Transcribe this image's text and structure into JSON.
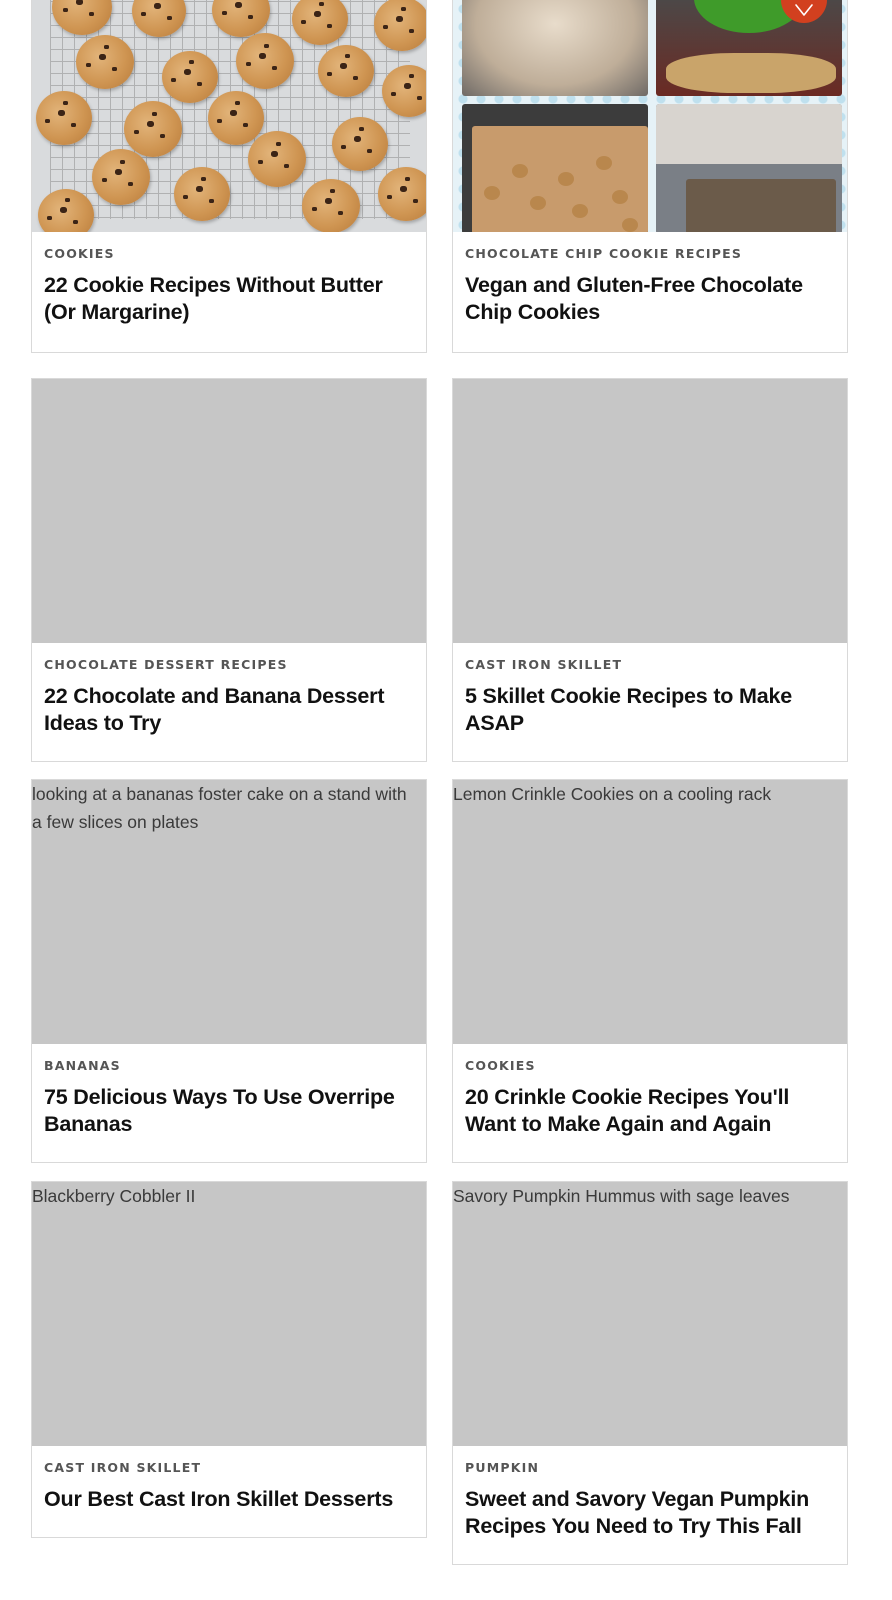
{
  "cards": [
    {
      "tag": "COOKIES",
      "title": "22 Cookie Recipes Without Butter (Or Margarine)",
      "image_alt": ""
    },
    {
      "tag": "CHOCOLATE CHIP COOKIE RECIPES",
      "title": "Vegan and Gluten-Free Chocolate Chip Cookies",
      "image_alt": ""
    },
    {
      "tag": "CHOCOLATE DESSERT RECIPES",
      "title": "22 Chocolate and Banana Dessert Ideas to Try",
      "image_alt": ""
    },
    {
      "tag": "CAST IRON SKILLET",
      "title": "5 Skillet Cookie Recipes to Make ASAP",
      "image_alt": ""
    },
    {
      "tag": "BANANAS",
      "title": "75 Delicious Ways To Use Overripe Bananas",
      "image_alt": "looking at a bananas foster cake on a stand with a few slices on plates"
    },
    {
      "tag": "COOKIES",
      "title": "20 Crinkle Cookie Recipes You'll Want to Make Again and Again",
      "image_alt": "Lemon Crinkle Cookies on a cooling rack"
    },
    {
      "tag": "CAST IRON SKILLET",
      "title": "Our Best Cast Iron Skillet Desserts",
      "image_alt": "Blackberry Cobbler II"
    },
    {
      "tag": "PUMPKIN",
      "title": "Sweet and Savory Vegan Pumpkin Recipes You Need to Try This Fall",
      "image_alt": "Savory Pumpkin Hummus with sage leaves"
    }
  ],
  "icons": {
    "save_button": "heart-icon"
  },
  "colors": {
    "placeholder_bg": "#c6c6c6",
    "accent": "#d2401f",
    "tag_text": "#555555",
    "title_text": "#111111",
    "card_border": "#d9d9d9"
  }
}
